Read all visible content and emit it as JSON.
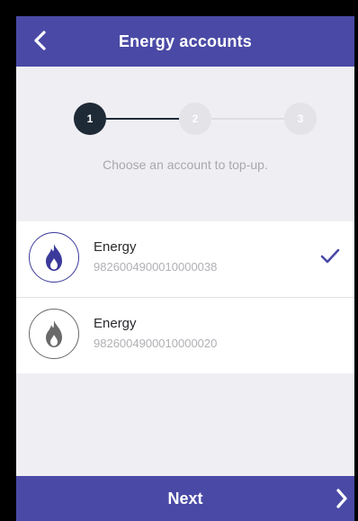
{
  "colors": {
    "brand": "#4a4aa6",
    "step_active": "#1f2a37",
    "step_inactive": "#e3e3e8",
    "accent_check": "#4a4aa6",
    "flame_selected": "#3b3a9a",
    "flame_unselected": "#6a6a6a"
  },
  "header": {
    "title": "Energy accounts",
    "back_icon": "chevron-left-icon"
  },
  "stepper": {
    "steps": [
      {
        "label": "1",
        "state": "active"
      },
      {
        "label": "2",
        "state": "inactive"
      },
      {
        "label": "3",
        "state": "inactive"
      }
    ]
  },
  "instruction": "Choose an account to top-up.",
  "accounts": [
    {
      "name": "Energy",
      "number": "9826004900010000038",
      "icon": "flame-icon",
      "selected": true
    },
    {
      "name": "Energy",
      "number": "9826004900010000020",
      "icon": "flame-icon",
      "selected": false
    }
  ],
  "footer": {
    "next_label": "Next",
    "next_icon": "chevron-right-icon"
  }
}
